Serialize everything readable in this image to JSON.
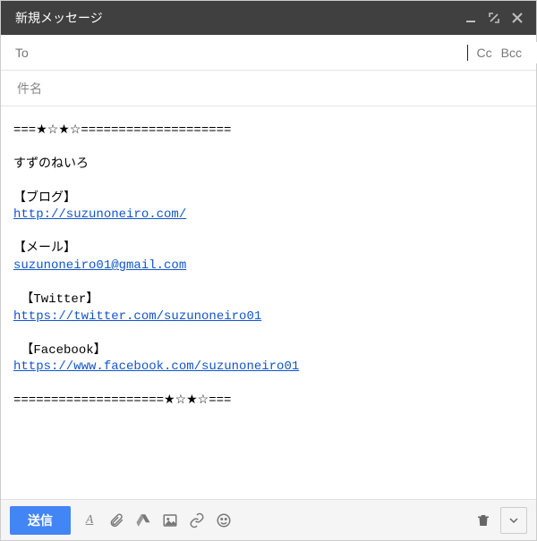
{
  "window": {
    "title": "新規メッセージ"
  },
  "to": {
    "label": "To",
    "value": "",
    "cc": "Cc",
    "bcc": "Bcc"
  },
  "subject": {
    "placeholder": "件名",
    "value": ""
  },
  "body": {
    "sep_top": "===★☆★☆====================",
    "name": "すずのねいろ",
    "blog_label": "【ブログ】",
    "blog_url": "http://suzunoneiro.com/",
    "mail_label": "【メール】",
    "mail_addr": "suzunoneiro01@gmail.com",
    "twitter_label": "【Twitter】",
    "twitter_url": "https://twitter.com/suzunoneiro01",
    "facebook_label": "【Facebook】",
    "facebook_url": "https://www.facebook.com/suzunoneiro01",
    "sep_bottom": "====================★☆★☆==="
  },
  "footer": {
    "send": "送信"
  },
  "icons": {
    "minimize": "minimize",
    "fullscreen": "fullscreen",
    "close": "close",
    "format_text": "A",
    "attach": "attach",
    "drive": "drive",
    "image": "image",
    "link": "link",
    "emoji": "emoji",
    "trash": "trash",
    "more": "more"
  }
}
